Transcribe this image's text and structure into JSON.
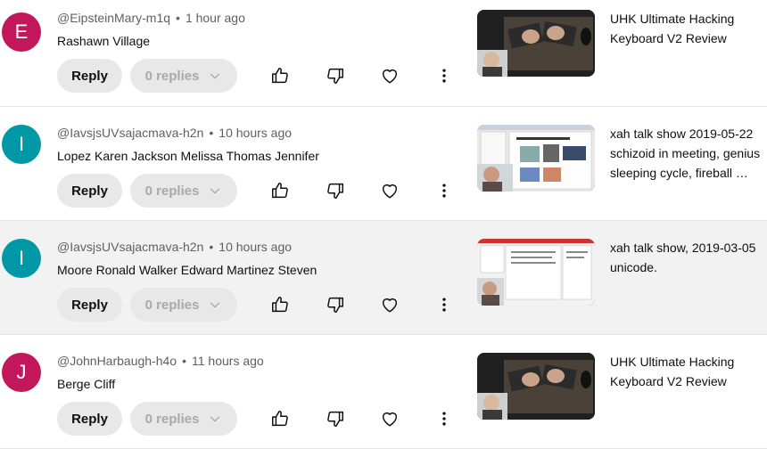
{
  "ui": {
    "reply_label": "Reply",
    "replies_label": "0 replies",
    "meta_separator": "•"
  },
  "icons": {
    "like": "thumb-up-icon",
    "dislike": "thumb-down-icon",
    "heart": "heart-icon",
    "more": "more-vert-icon",
    "chevron": "chevron-down-icon"
  },
  "comments": [
    {
      "avatar_letter": "E",
      "avatar_color": "#c2185b",
      "author": "@EipsteinMary-m1q",
      "time": "1 hour ago",
      "text": "Rashawn Village",
      "video_title": "UHK Ultimate Hacking Keyboard V2 Review",
      "thumb_style": "keyboard"
    },
    {
      "avatar_letter": "I",
      "avatar_color": "#0097a7",
      "author": "@IavsjsUVsajacmava-h2n",
      "time": "10 hours ago",
      "text": "Lopez Karen Jackson Melissa Thomas Jennifer",
      "video_title": "xah talk show 2019-05-22 schizoid in meeting, genius sleeping cycle, fireball …",
      "thumb_style": "desktop"
    },
    {
      "avatar_letter": "I",
      "avatar_color": "#0097a7",
      "author": "@IavsjsUVsajacmava-h2n",
      "time": "10 hours ago",
      "text": "Moore Ronald Walker Edward Martinez Steven",
      "video_title": "xah talk show, 2019-03-05 unicode.",
      "thumb_style": "desktop2"
    },
    {
      "avatar_letter": "J",
      "avatar_color": "#c2185b",
      "author": "@JohnHarbaugh-h4o",
      "time": "11 hours ago",
      "text": "Berge Cliff",
      "video_title": "UHK Ultimate Hacking Keyboard V2 Review",
      "thumb_style": "keyboard"
    }
  ]
}
